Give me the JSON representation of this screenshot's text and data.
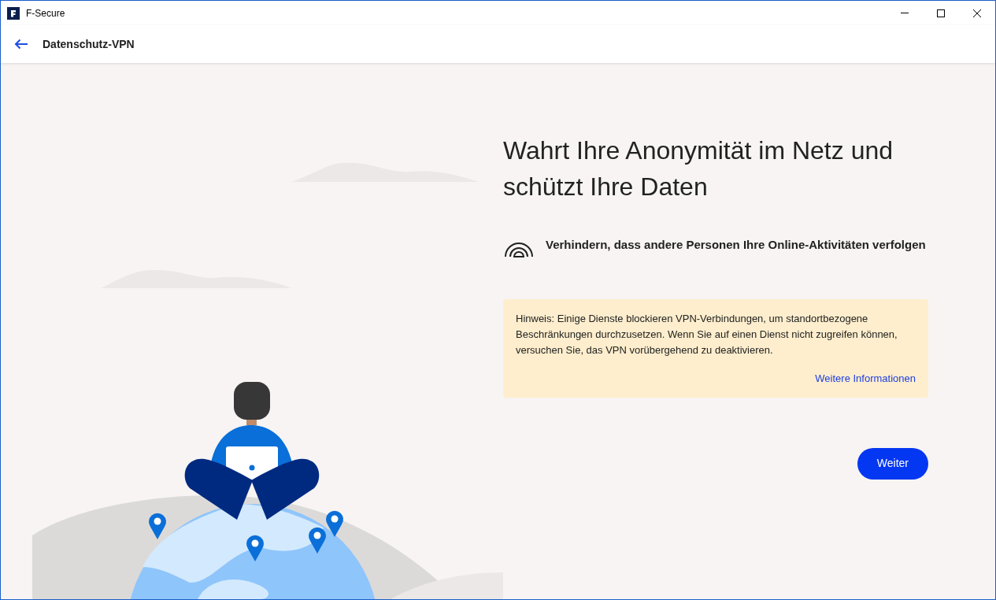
{
  "window": {
    "title": "F-Secure"
  },
  "header": {
    "title": "Datenschutz-VPN"
  },
  "heading": "Wahrt Ihre Anonymität im Netz und schützt Ihre Daten",
  "features": [
    {
      "text": "Verhindern, dass andere Personen Ihre Online-Aktivitäten verfolgen"
    }
  ],
  "notice": {
    "text": "Hinweis: Einige Dienste blockieren VPN-Verbindungen, um standortbezogene Beschränkungen durchzusetzen. Wenn Sie auf einen Dienst nicht zugreifen können, versuchen Sie, das VPN vorübergehend zu deaktivieren.",
    "link": "Weitere Informationen"
  },
  "buttons": [
    "Weiter"
  ]
}
